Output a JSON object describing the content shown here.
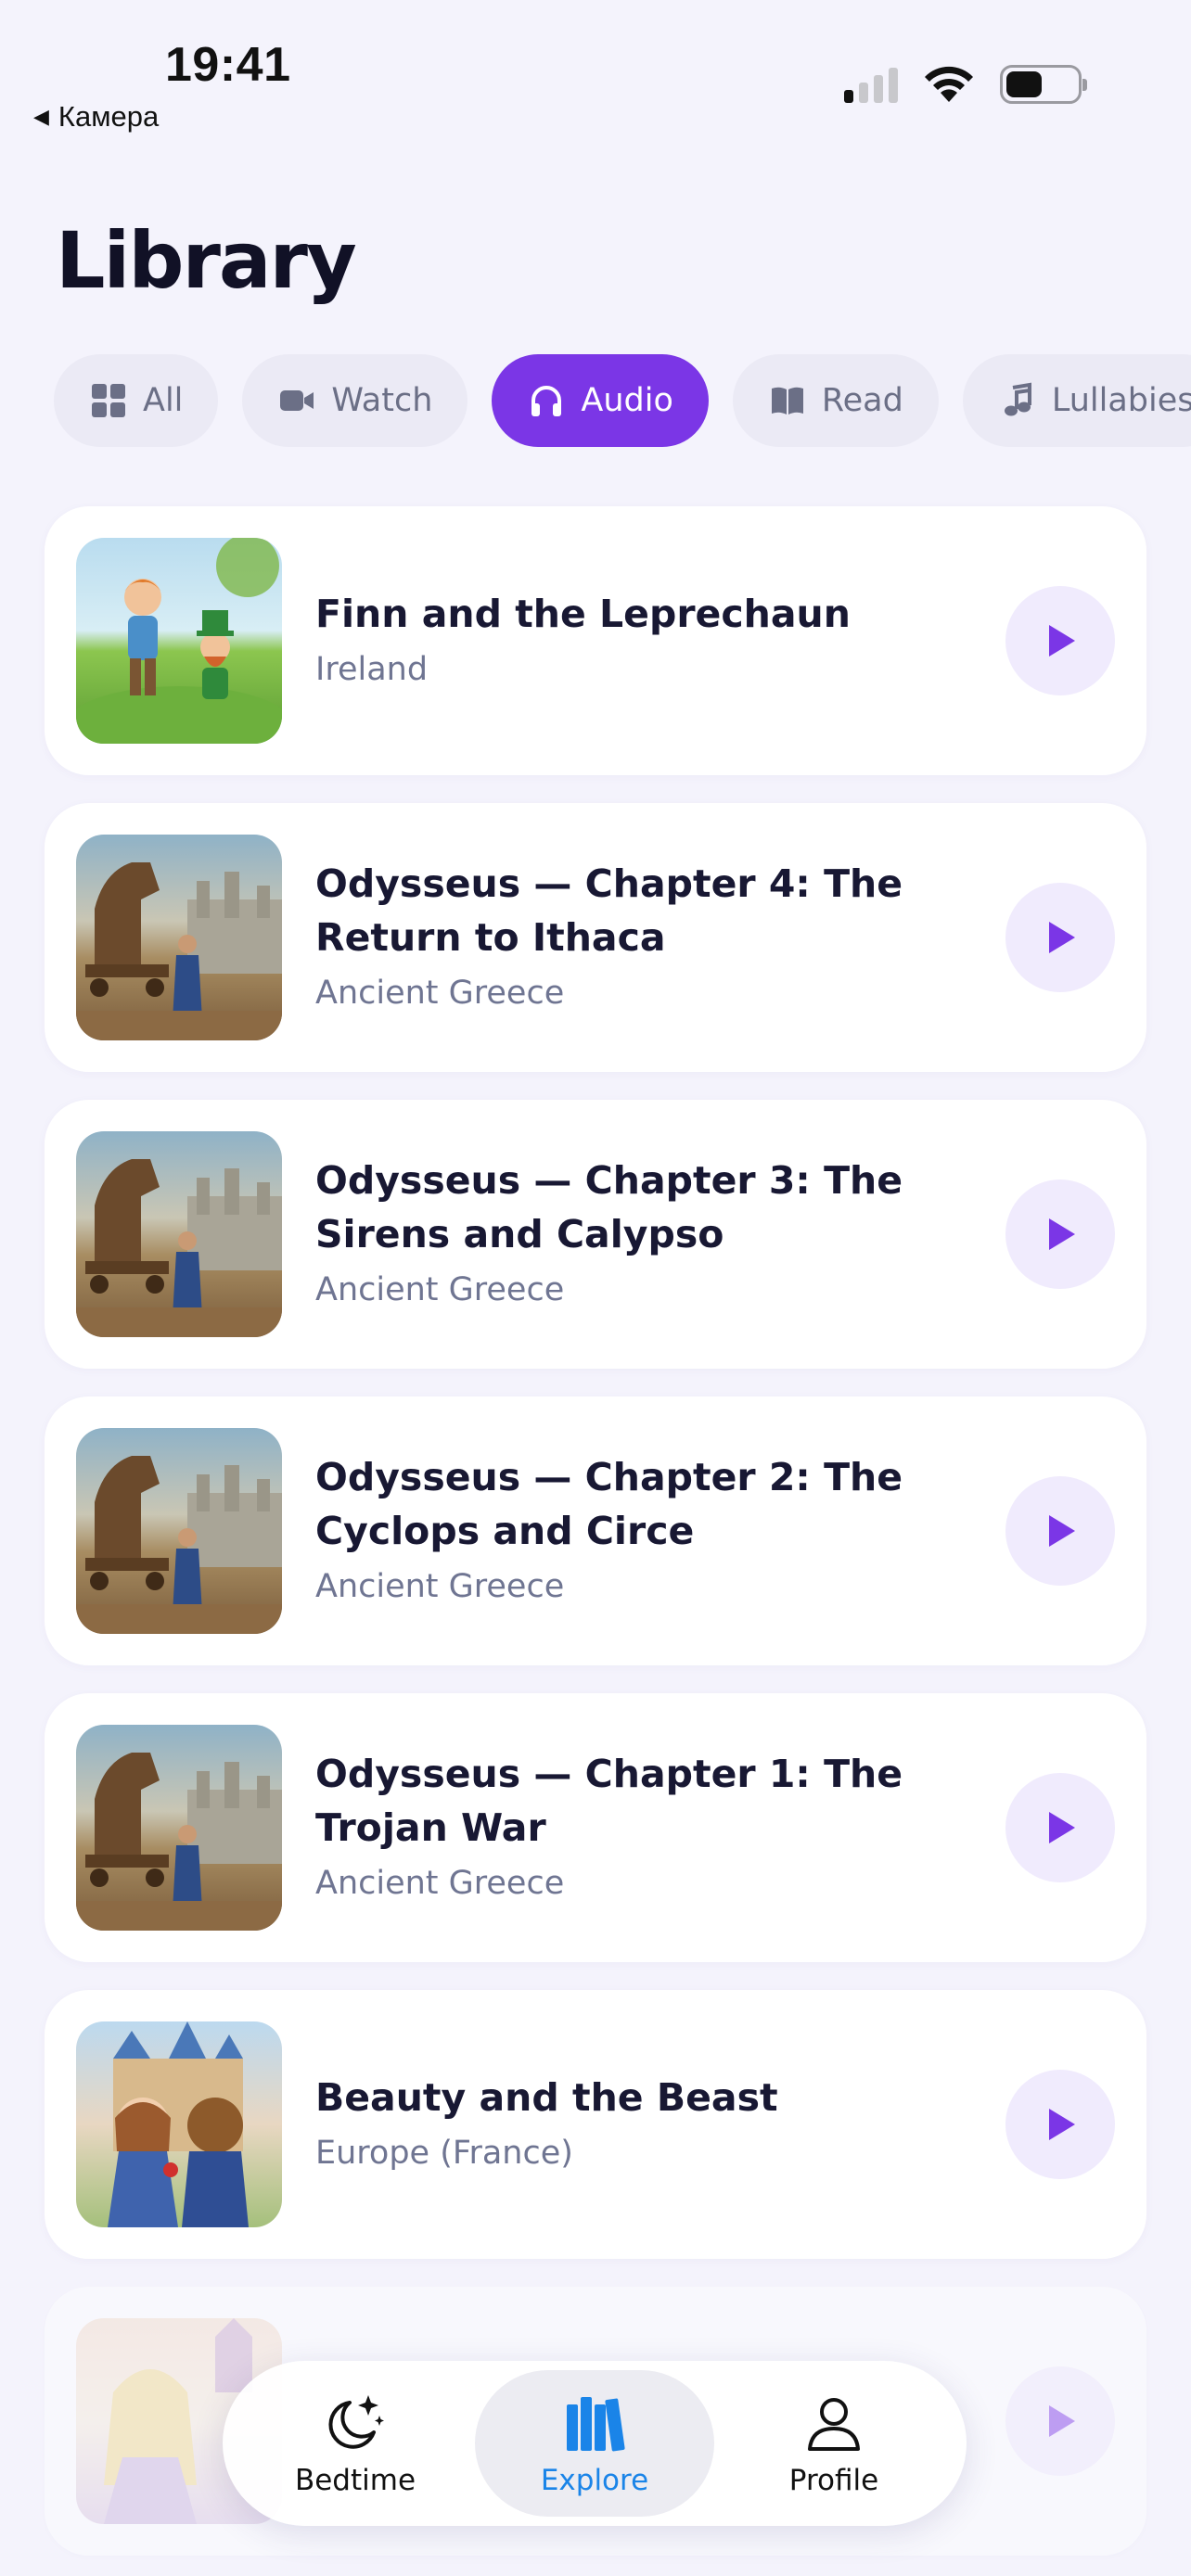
{
  "status_bar": {
    "time": "19:41",
    "back_label": "Камера"
  },
  "header": {
    "title": "Library"
  },
  "tabs": [
    {
      "label": "All",
      "icon": "grid-icon",
      "active": false
    },
    {
      "label": "Watch",
      "icon": "video-icon",
      "active": false
    },
    {
      "label": "Audio",
      "icon": "headphones-icon",
      "active": true
    },
    {
      "label": "Read",
      "icon": "book-icon",
      "active": false
    },
    {
      "label": "Lullabies",
      "icon": "music-note-icon",
      "active": false
    }
  ],
  "stories": [
    {
      "title": "Finn and the Leprechaun",
      "region": "Ireland"
    },
    {
      "title": "Odysseus — Chapter 4: The Return to Ithaca",
      "region": "Ancient Greece"
    },
    {
      "title": "Odysseus — Chapter 3: The Sirens and Calypso",
      "region": "Ancient Greece"
    },
    {
      "title": "Odysseus — Chapter 2: The Cyclops and Circe",
      "region": "Ancient Greece"
    },
    {
      "title": "Odysseus — Chapter 1: The Trojan War",
      "region": "Ancient Greece"
    },
    {
      "title": "Beauty and the Beast",
      "region": "Europe (France)"
    }
  ],
  "colors": {
    "accent": "#7b36e6",
    "nav_active": "#1a84e8",
    "background": "#f4f3fc"
  },
  "bottom_nav": {
    "items": [
      {
        "label": "Bedtime",
        "icon": "moon-stars-icon",
        "active": false
      },
      {
        "label": "Explore",
        "icon": "library-books-icon",
        "active": true
      },
      {
        "label": "Profile",
        "icon": "person-icon",
        "active": false
      }
    ]
  }
}
